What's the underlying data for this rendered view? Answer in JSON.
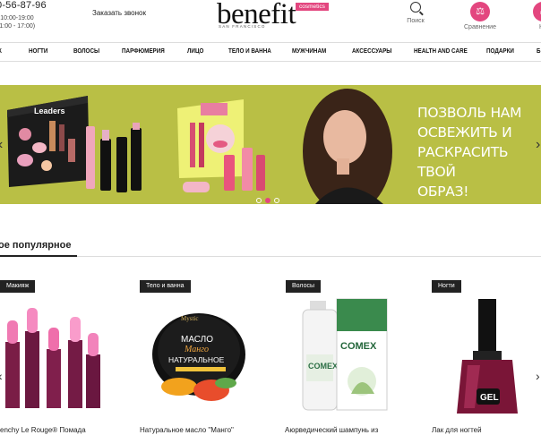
{
  "header": {
    "phone": "0-56-87-96",
    "hours_line1": "- 10:00-19:00",
    "hours_line2": "11:00 - 17:00)",
    "callback": "Заказать звонок",
    "logo_word": "benefit",
    "logo_sub": "SAN FRANCISCO",
    "logo_badge": "cosmetics",
    "search_label": "Поиск",
    "compare_label": "Сравнение",
    "compare_icon": "scales-icon",
    "cart_label": "Ко"
  },
  "nav": {
    "items": [
      "К",
      "Ногти",
      "Волосы",
      "Парфюмерия",
      "Лицо",
      "Тело и ванна",
      "Мужчинам",
      "Аксессуары",
      "Health and care",
      "Подарки",
      "Б"
    ]
  },
  "banner": {
    "line1": "Позволь нам",
    "line2": "освежить и",
    "line3": "раскрасить твой",
    "line4": "образ!",
    "product_label": "Leaders",
    "left_arrow": "‹",
    "right_arrow": "›",
    "slide_count": 3,
    "active_slide": 2
  },
  "section": {
    "title": "ое популярное"
  },
  "products": [
    {
      "category": "Макияж",
      "title": "venchy Le Rouge® Помада"
    },
    {
      "category": "Тело и ванна",
      "title": "Натуральное масло \"Манго\""
    },
    {
      "category": "Волосы",
      "title": "Аюрведический шампунь из"
    },
    {
      "category": "Ногти",
      "title": "Лак для ногтей"
    }
  ],
  "jar_text": {
    "brand": "Mystic",
    "line1": "МАСЛО",
    "line2": "Манго",
    "line3": "НАТУРАЛЬНОЕ"
  },
  "shampoo_text": {
    "brand": "COMEX"
  },
  "polish_text": {
    "line": "GEL"
  },
  "colors": {
    "accent": "#e3467f",
    "banner_bg": "#b9bf45"
  }
}
